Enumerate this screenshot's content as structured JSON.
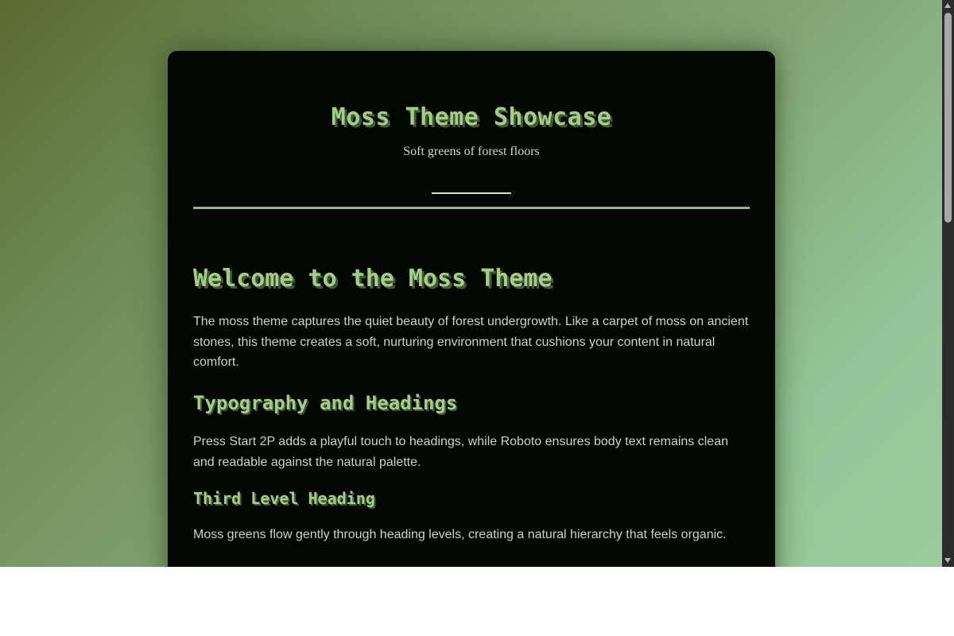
{
  "header": {
    "title": "Moss Theme Showcase",
    "subtitle": "Soft greens of forest floors"
  },
  "content": {
    "heading_welcome": "Welcome to the Moss Theme",
    "intro": "The moss theme captures the quiet beauty of forest undergrowth. Like a carpet of moss on ancient stones, this theme creates a soft, nurturing environment that cushions your content in natural comfort.",
    "heading_typography": "Typography and Headings",
    "typography_text": "Press Start 2P adds a playful touch to headings, while Roboto ensures body text remains clean and readable against the natural palette.",
    "heading_third": "Third Level Heading",
    "third_text": "Moss greens flow gently through heading levels, creating a natural hierarchy that feels organic."
  },
  "colors": {
    "heading": "#a6cc8c",
    "heading_shadow": "#3d5c2e",
    "card_background": "#030703",
    "body_text": "#cdd3c9",
    "accent_rule": "#98b47c"
  }
}
